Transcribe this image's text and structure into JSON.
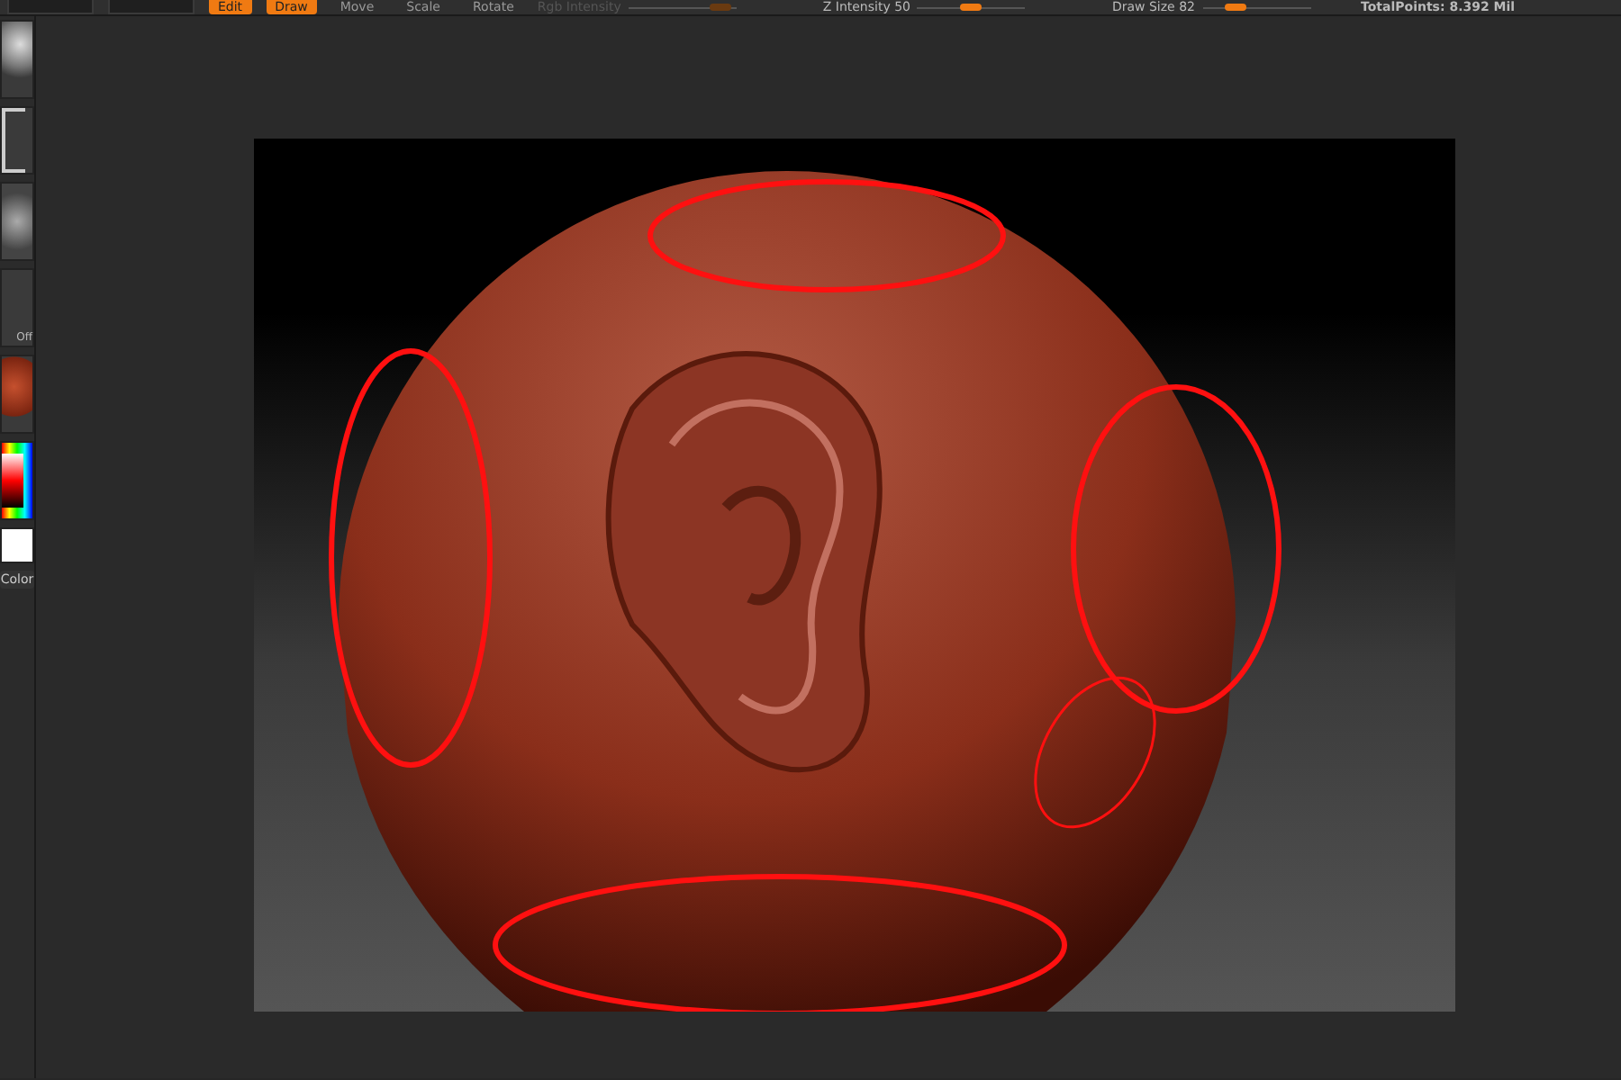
{
  "toolbar": {
    "buttons": [
      {
        "label": "Edit",
        "selected": true
      },
      {
        "label": "Draw",
        "selected": true
      },
      {
        "label": "Move",
        "selected": false
      },
      {
        "label": "Scale",
        "selected": false
      },
      {
        "label": "Rotate",
        "selected": false
      }
    ],
    "sliders": [
      {
        "label": "Rgb Intensity",
        "disabled": true,
        "level": 0.85
      },
      {
        "label": "Z Intensity 50",
        "disabled": false,
        "level": 0.5
      },
      {
        "label": "Draw Size 82",
        "disabled": false,
        "level": 0.3
      }
    ],
    "total_points": "TotalPoints: 8.392 Mil"
  },
  "shelf": [
    {
      "kind": "brush"
    },
    {
      "kind": "stroke"
    },
    {
      "kind": "alpha"
    },
    {
      "kind": "texture",
      "label": "Off"
    },
    {
      "kind": "material"
    },
    {
      "kind": "picker"
    },
    {
      "kind": "swatch"
    },
    {
      "kind": "button",
      "label": "Color"
    }
  ],
  "viewport": {
    "annotations": [
      {
        "kind": "ellipse"
      },
      {
        "kind": "ellipse"
      },
      {
        "kind": "ellipse"
      },
      {
        "kind": "thin-ellipse"
      },
      {
        "kind": "ellipse"
      }
    ]
  }
}
